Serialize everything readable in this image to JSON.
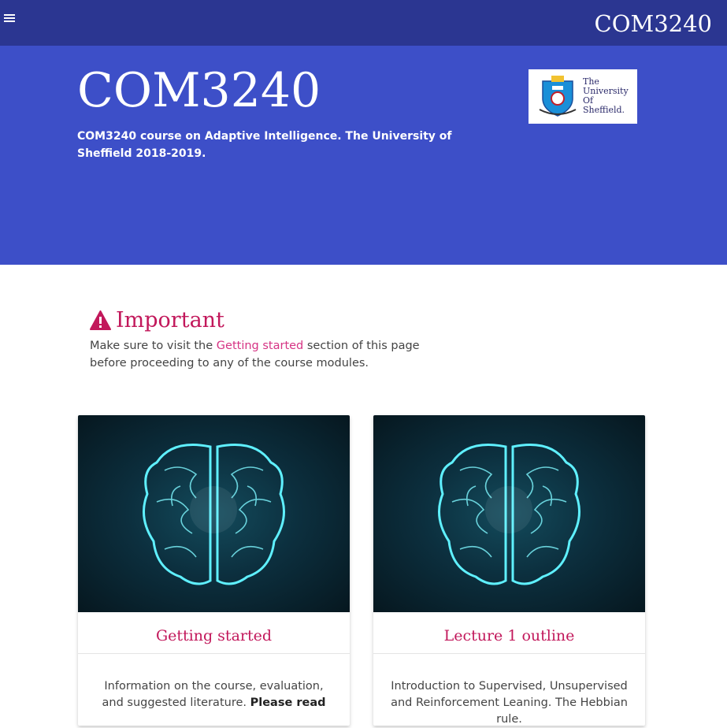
{
  "nav": {
    "title": "COM3240"
  },
  "hero": {
    "title": "COM3240",
    "description": "COM3240 course on Adaptive Intelligence. The University of Sheffield 2018-2019.",
    "logo": {
      "line1": "The",
      "line2": "University",
      "line3": "Of",
      "line4": "Sheffield."
    }
  },
  "important": {
    "heading": "Important",
    "text_before": "Make sure to visit the ",
    "link": "Getting started",
    "text_after": " section of this page before proceeding to any of the course modules."
  },
  "cards": [
    {
      "title": "Getting started",
      "body": "Information on the course, evaluation, and suggested literature. ",
      "body_bold": "Please read"
    },
    {
      "title": "Lecture 1 outline",
      "body": "Introduction to Supervised, Unsupervised and Reinforcement Leaning. The Hebbian rule.",
      "body_bold": ""
    }
  ],
  "colors": {
    "nav": "#2b3691",
    "hero": "#3d4fc8",
    "accent": "#c2185b"
  }
}
